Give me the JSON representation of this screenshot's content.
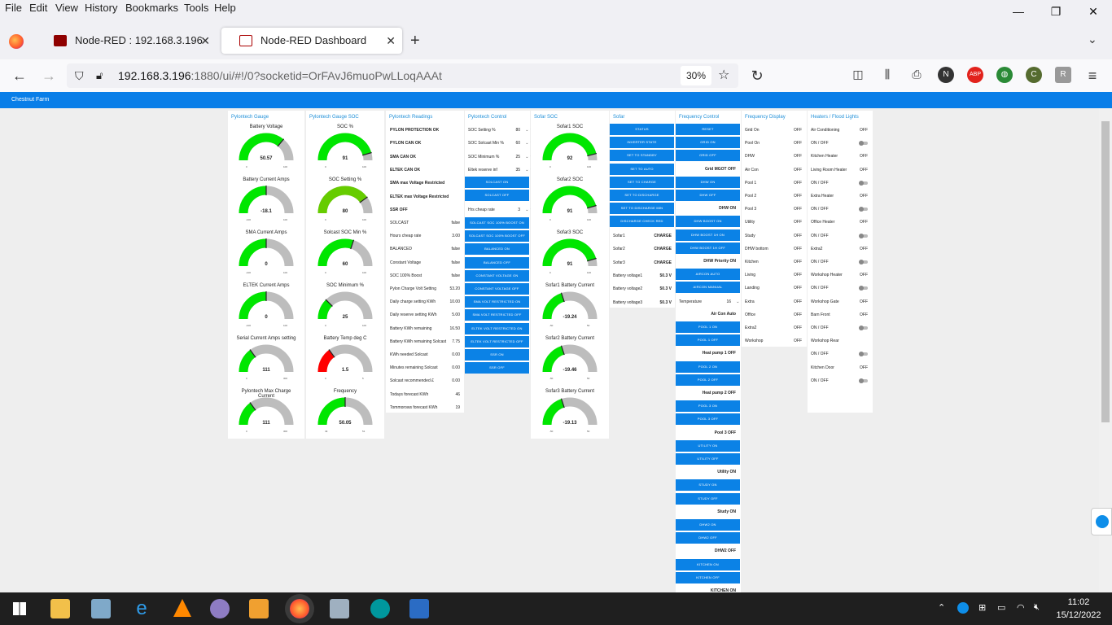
{
  "menu": [
    "File",
    "Edit",
    "View",
    "History",
    "Bookmarks",
    "Tools",
    "Help"
  ],
  "tabs": [
    {
      "title": "Node-RED : 192.168.3.196"
    },
    {
      "title": "Node-RED Dashboard"
    }
  ],
  "url": {
    "host": "192.168.3.196",
    "rest": ":1880/ui/#!/0?socketid=OrFAvJ6muoPwLLoqAAAt",
    "zoom": "30%"
  },
  "dashboard": {
    "title": "Chestnut Farm"
  },
  "groups": {
    "pylontech_gauge": {
      "title": "Pylontech Gauge",
      "gauges": [
        {
          "label": "Battery Voltage",
          "value": "50.57",
          "fraction": 0.72,
          "color": "#00e600",
          "min": "0",
          "max": "100"
        },
        {
          "label": "Battery Current Amps",
          "value": "-18.1",
          "fraction": 0.5,
          "color": "#00e600",
          "min": "-100",
          "max": "100"
        },
        {
          "label": "SMA Current Amps",
          "value": "0",
          "fraction": 0.5,
          "color": "#00e600",
          "min": "-100",
          "max": "100"
        },
        {
          "label": "ELTEK Current Amps",
          "value": "0",
          "fraction": 0.5,
          "color": "#00e600",
          "min": "-100",
          "max": "100"
        },
        {
          "label": "Serial Current Amps setting",
          "value": "111",
          "fraction": 0.3,
          "color": "#00e600",
          "min": "0",
          "max": "300"
        },
        {
          "label": "Pylontech Max Charge Current",
          "value": "111",
          "fraction": 0.3,
          "color": "#00e600",
          "min": "0",
          "max": "300"
        }
      ]
    },
    "pylontech_soc": {
      "title": "Pylontech Gauge SOC",
      "gauges": [
        {
          "label": "SOC %",
          "value": "91",
          "fraction": 0.91,
          "color": "#00e600",
          "min": "0",
          "max": "100"
        },
        {
          "label": "SOC Setting %",
          "value": "80",
          "fraction": 0.8,
          "color": "#66cc00",
          "min": "0",
          "max": "100"
        },
        {
          "label": "Solcast SOC Min %",
          "value": "60",
          "fraction": 0.6,
          "color": "#00e600",
          "min": "0",
          "max": "100"
        },
        {
          "label": "SOC Minimum %",
          "value": "25",
          "fraction": 0.25,
          "color": "#00e600",
          "min": "0",
          "max": "100"
        },
        {
          "label": "Battery Temp deg C",
          "value": "1.5",
          "fraction": 0.3,
          "color": "#ff0000",
          "min": "0",
          "max": "5"
        },
        {
          "label": "Frequency",
          "value": "50.05",
          "fraction": 0.5,
          "color": "#00e600",
          "min": "49",
          "max": "51"
        }
      ]
    },
    "readings": {
      "title": "Pylontech Readings",
      "status": [
        "PYLON PROTECTION OK",
        "PYLON CAN OK",
        "SMA CAN OK",
        "ELTEK CAN OK",
        "SMA max Voltage Restricted",
        "ELTEK max Voltage Restricted",
        "SSR OFF"
      ],
      "rows": [
        [
          "SOLCAST",
          "false"
        ],
        [
          "Hours cheap rate",
          "3.00"
        ],
        [
          "BALANCED",
          "false"
        ],
        [
          "Constant Voltage",
          "false"
        ],
        [
          "SOC 100% Boost",
          "false"
        ],
        [
          "Pylon Charge Volt Setting",
          "53.20"
        ],
        [
          "Daily charge setting KWh",
          "10.00"
        ],
        [
          "Daily reserve setting KWh",
          "5.00"
        ],
        [
          "Battery KWh remaining",
          "16.50"
        ],
        [
          "Battery KWh remaining Solcast",
          "7.75"
        ],
        [
          "KWh needed Solcast",
          "0.00"
        ],
        [
          "Minutes remaining Solcast",
          "0.00"
        ],
        [
          "Solcast recommended £",
          "0.00"
        ],
        [
          "Todays forecast KWh",
          "46"
        ],
        [
          "Tommorows forecast KWh",
          "19"
        ]
      ]
    },
    "control": {
      "title": "Pylontech Control",
      "numbers": [
        [
          "SOC Setting %",
          "80"
        ],
        [
          "SOC Solcast Min %",
          "60"
        ],
        [
          "SOC Minimum %",
          "25"
        ],
        [
          "Eltek reserve inf",
          "35"
        ]
      ],
      "cheap": [
        "Hrs cheap rate",
        "3"
      ],
      "buttons_a": [
        "SOLCAST ON",
        "SOLCAST OFF"
      ],
      "buttons_b": [
        "SOLCAST SOC 100% BOOST ON",
        "SOLCAST SOC 100% BOOST OFF",
        "BALANCED ON",
        "BALANCED OFF",
        "CONSTANT VOLTAGE ON",
        "CONSTANT VOLTAGE OFF",
        "SMA VOLT RESTRICTED ON",
        "SMA VOLT RESTRICTED OFF",
        "ELTEK VOLT RESTRICTED ON",
        "ELTEK VOLT RESTRICTED OFF",
        "SSR ON",
        "SSR OFF"
      ]
    },
    "sofar_soc": {
      "title": "Sofar SOC",
      "gauges": [
        {
          "label": "Sofar1 SOC",
          "value": "92",
          "fraction": 0.92,
          "color": "#00e600",
          "min": "0",
          "max": "100"
        },
        {
          "label": "Sofar2 SOC",
          "value": "91",
          "fraction": 0.91,
          "color": "#00e600",
          "min": "0",
          "max": "100"
        },
        {
          "label": "Sofar3 SOC",
          "value": "91",
          "fraction": 0.91,
          "color": "#00e600",
          "min": "0",
          "max": "100"
        },
        {
          "label": "Sofar1 Battery Current",
          "value": "-19.24",
          "fraction": 0.4,
          "color": "#00e600",
          "min": "-50",
          "max": "50"
        },
        {
          "label": "Sofar2 Battery Current",
          "value": "-19.46",
          "fraction": 0.4,
          "color": "#00e600",
          "min": "-50",
          "max": "50"
        },
        {
          "label": "Sofar3 Battery Current",
          "value": "-19.13",
          "fraction": 0.4,
          "color": "#00e600",
          "min": "-50",
          "max": "50"
        }
      ]
    },
    "sofar": {
      "title": "Sofar",
      "buttons": [
        "STATUS",
        "INVERTER STATE",
        "SET TO STANDBY",
        "SET TO AUTO",
        "SET TO CHARGE",
        "SET TO DISCHARGE",
        "SET TO DISCHARGE MIN",
        "DISCHARGE CHECK RED"
      ],
      "rows": [
        [
          "Sofar1",
          "CHARGE"
        ],
        [
          "Sofar2",
          "CHARGE"
        ],
        [
          "Sofar3",
          "CHARGE"
        ],
        [
          "Battery voltage1",
          "50.3 V"
        ],
        [
          "Battery voltage2",
          "50.3 V"
        ],
        [
          "Battery voltage3",
          "50.3 V"
        ]
      ]
    },
    "freq_control": {
      "title": "Frequency Control",
      "items": [
        {
          "t": "b",
          "v": "RESET"
        },
        {
          "t": "b",
          "v": "GRID ON"
        },
        {
          "t": "b",
          "v": "GRID OFF"
        },
        {
          "t": "l",
          "v": "Grid MGOT OFF"
        },
        {
          "t": "b",
          "v": "DHW ON"
        },
        {
          "t": "b",
          "v": "DHW OFF"
        },
        {
          "t": "l",
          "v": "DHW ON"
        },
        {
          "t": "b",
          "v": "DHW BOOST ON"
        },
        {
          "t": "b",
          "v": "DHW BOOST 1H ON"
        },
        {
          "t": "b",
          "v": "DHW BOOST 1H OFF"
        },
        {
          "t": "l",
          "v": "DHW Priority ON"
        },
        {
          "t": "b",
          "v": "AIRCON AUTO"
        },
        {
          "t": "b",
          "v": "AIRCON MANUAL"
        },
        {
          "t": "n",
          "v": "Temperature",
          "n": "16"
        },
        {
          "t": "l",
          "v": "Air Con Auto"
        },
        {
          "t": "b",
          "v": "POOL 1 ON"
        },
        {
          "t": "b",
          "v": "POOL 1 OFF"
        },
        {
          "t": "l",
          "v": "Heat pump 1 OFF"
        },
        {
          "t": "b",
          "v": "POOL 2 ON"
        },
        {
          "t": "b",
          "v": "POOL 2 OFF"
        },
        {
          "t": "l",
          "v": "Heat pump 2 OFF"
        },
        {
          "t": "b",
          "v": "POOL 3 ON"
        },
        {
          "t": "b",
          "v": "POOL 3 OFF"
        },
        {
          "t": "l",
          "v": "Pool 3 OFF"
        },
        {
          "t": "b",
          "v": "UTILITY ON"
        },
        {
          "t": "b",
          "v": "UTILITY OFF"
        },
        {
          "t": "l",
          "v": "Utility ON"
        },
        {
          "t": "b",
          "v": "STUDY ON"
        },
        {
          "t": "b",
          "v": "STUDY OFF"
        },
        {
          "t": "l",
          "v": "Study ON"
        },
        {
          "t": "b",
          "v": "DHW2 ON"
        },
        {
          "t": "b",
          "v": "DHW2 OFF"
        },
        {
          "t": "l",
          "v": "DHW2 OFF"
        },
        {
          "t": "b",
          "v": "KITCHEN ON"
        },
        {
          "t": "b",
          "v": "KITCHEN OFF"
        },
        {
          "t": "l",
          "v": "KITCHEN ON"
        }
      ]
    },
    "freq_display": {
      "title": "Frequency Display",
      "rows": [
        [
          "Grid On",
          "OFF"
        ],
        [
          "Pool On",
          "OFF"
        ],
        [
          "DHW",
          "OFF"
        ],
        [
          "Air Con",
          "OFF"
        ],
        [
          "Pool 1",
          "OFF"
        ],
        [
          "Pool 2",
          "OFF"
        ],
        [
          "Pool 3",
          "OFF"
        ],
        [
          "Utility",
          "OFF"
        ],
        [
          "Study",
          "OFF"
        ],
        [
          "DHW bottom",
          "OFF"
        ],
        [
          "Kitchen",
          "OFF"
        ],
        [
          "Living",
          "OFF"
        ],
        [
          "Landing",
          "OFF"
        ],
        [
          "Extra",
          "OFF"
        ],
        [
          "Office",
          "OFF"
        ],
        [
          "Extra2",
          "OFF"
        ],
        [
          "Workshop",
          "OFF"
        ]
      ]
    },
    "heaters": {
      "title": "Heaters / Flood Lights",
      "rows": [
        {
          "l": "Air Conditioning",
          "v": "OFF"
        },
        {
          "l": "ON / OFF",
          "sw": true
        },
        {
          "l": "Kitchen Heater",
          "v": "OFF"
        },
        {
          "l": "Living Room Heater",
          "v": "OFF"
        },
        {
          "l": "ON / OFF",
          "sw": true
        },
        {
          "l": "Extra Heater",
          "v": "OFF"
        },
        {
          "l": "ON / OFF",
          "sw": true
        },
        {
          "l": "Office Heater",
          "v": "OFF"
        },
        {
          "l": "ON / OFF",
          "sw": true
        },
        {
          "l": "Extra2",
          "v": "OFF"
        },
        {
          "l": "ON / OFF",
          "sw": true
        },
        {
          "l": "Workshop Heater",
          "v": "OFF"
        },
        {
          "l": "ON / OFF",
          "sw": true
        },
        {
          "l": "Workshop Gate",
          "v": "OFF"
        },
        {
          "l": "Barn Front",
          "v": "OFF"
        },
        {
          "l": "ON / OFF",
          "sw": true
        },
        {
          "l": "Workshop Rear",
          "v": ""
        },
        {
          "l": "ON / OFF",
          "sw": true
        },
        {
          "l": "Kitchen Door",
          "v": "OFF"
        },
        {
          "l": "ON / OFF",
          "sw": true
        }
      ]
    }
  },
  "taskbar": {
    "time": "11:02",
    "date": "15/12/2022"
  }
}
